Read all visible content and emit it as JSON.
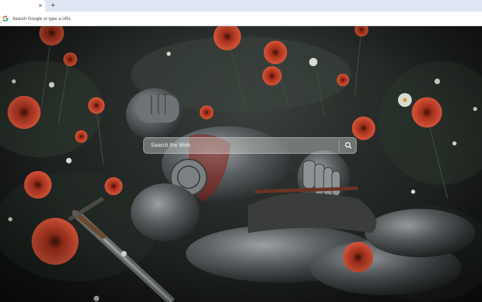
{
  "tab": {
    "close": "×"
  },
  "new_tab_button": "+",
  "omnibox": {
    "placeholder": "Search Google or type a URL"
  },
  "search": {
    "placeholder": "Search the Web"
  },
  "icons": {
    "omnibox": "google-g-icon",
    "search": "magnifier-icon",
    "close": "close-icon"
  },
  "background": {
    "description_icon": "wallpaper-image"
  }
}
